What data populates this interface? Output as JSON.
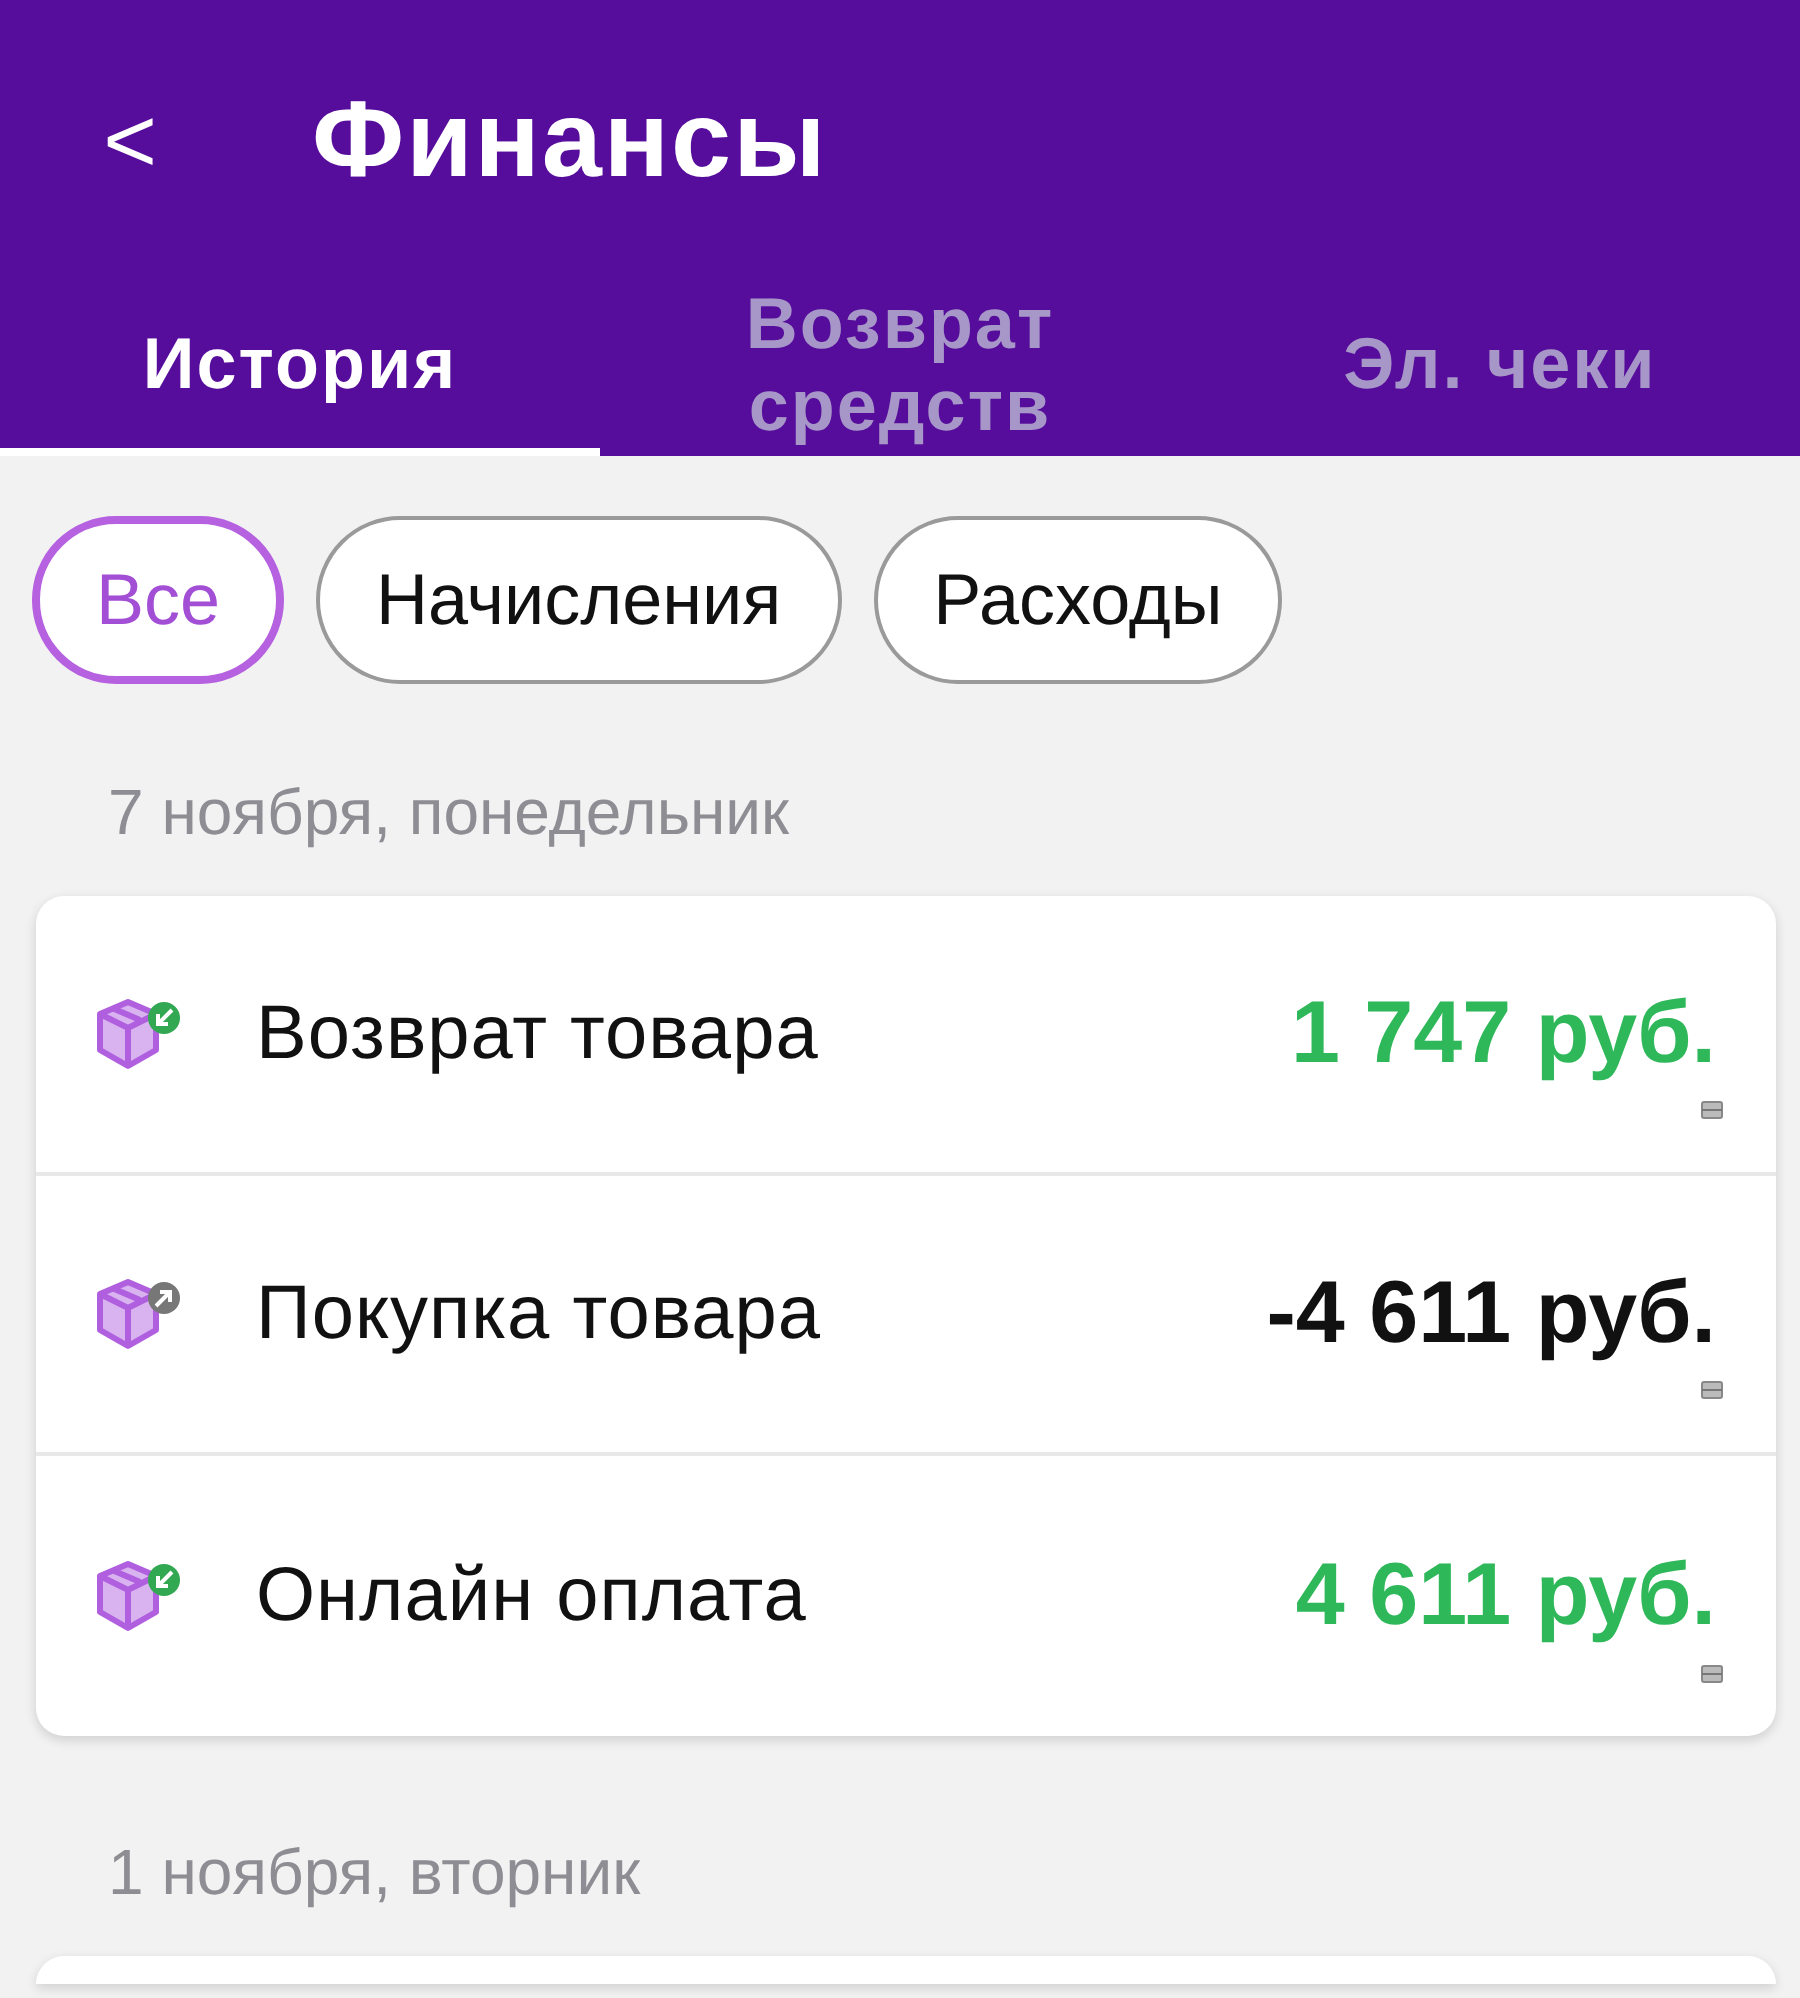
{
  "header": {
    "back": "<",
    "title": "Финансы"
  },
  "tabs": [
    {
      "label": "История",
      "selected": true
    },
    {
      "label": "Возврат средств",
      "selected": false
    },
    {
      "label": "Эл. чеки",
      "selected": false
    }
  ],
  "filters": [
    {
      "label": "Все",
      "selected": true
    },
    {
      "label": "Начисления",
      "selected": false
    },
    {
      "label": "Расходы",
      "selected": false
    }
  ],
  "days": [
    {
      "date": "7 ноября, понедельник",
      "operations": [
        {
          "title": "Возврат товара",
          "amount": "1 747 руб.",
          "kind": "in"
        },
        {
          "title": "Покупка товара",
          "amount": "-4 611 руб.",
          "kind": "out"
        },
        {
          "title": "Онлайн оплата",
          "amount": "4 611 руб.",
          "kind": "in"
        }
      ]
    },
    {
      "date": "1 ноября, вторник"
    }
  ]
}
